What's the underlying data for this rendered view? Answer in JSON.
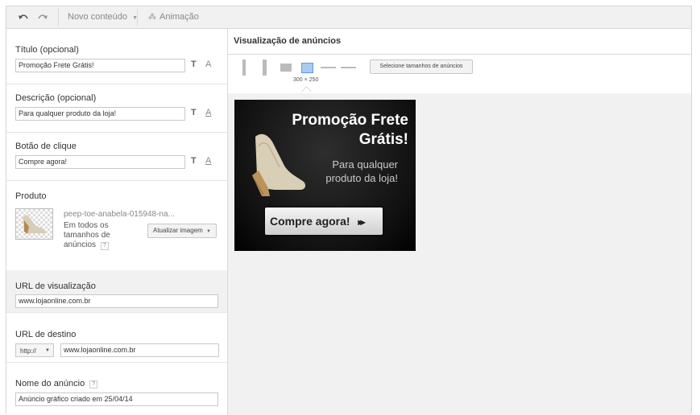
{
  "toolbar": {
    "undo_icon": "undo-icon",
    "redo_icon": "redo-icon",
    "new_content_label": "Novo conteúdo",
    "animation_label": "Animação"
  },
  "fields": {
    "title": {
      "label": "Título (opcional)",
      "value": "Promoção Frete Grátis!"
    },
    "description": {
      "label": "Descrição (opcional)",
      "value": "Para qualquer produto da loja!"
    },
    "button": {
      "label": "Botão de clique",
      "value": "Compre agora!"
    },
    "product": {
      "label": "Produto",
      "filename": "peep-toe-anabela-015948-na...",
      "sizes_text": "Em todos os tamanhos de anúncios",
      "help": "?",
      "update_button": "Atualizar imagem"
    },
    "display_url": {
      "label": "URL de visualização",
      "value": "www.lojaonline.com.br"
    },
    "dest_url": {
      "label": "URL de destino",
      "protocol": "http://",
      "value": "www.lojaonline.com.br"
    },
    "ad_name": {
      "label": "Nome do anúncio",
      "help": "?",
      "value": "Anúncio gráfico criado em 25/04/14"
    }
  },
  "format": {
    "text": "T",
    "font": "A"
  },
  "preview": {
    "title": "Visualização de anúncios",
    "selected_size": "300 × 250",
    "select_sizes_button": "Selecione tamanhos de anúncios",
    "ad": {
      "headline_1": "Promoção Frete",
      "headline_2": "Grátis!",
      "desc_1": "Para qualquer",
      "desc_2": "produto da loja!",
      "cta": "Compre agora!",
      "cta_icon": "▸▸"
    }
  }
}
